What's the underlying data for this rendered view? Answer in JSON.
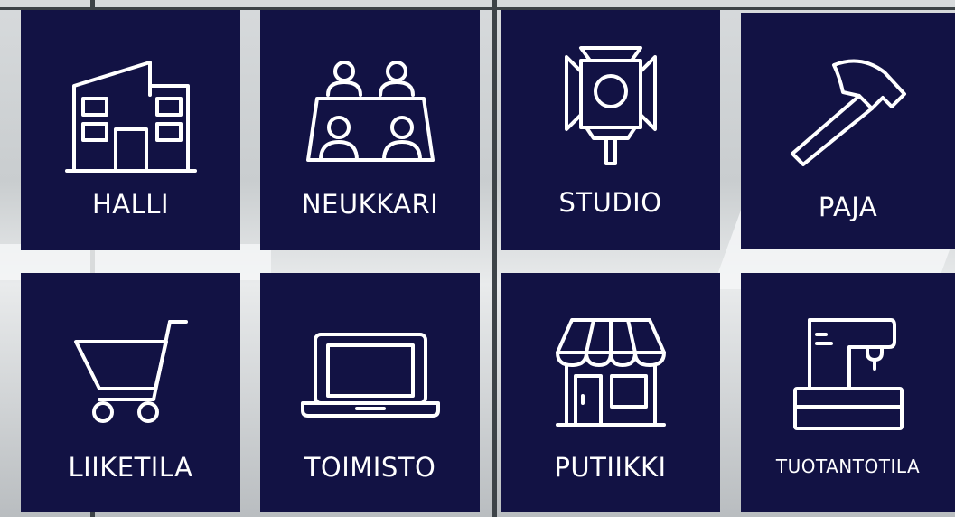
{
  "tiles": [
    {
      "label": "HALLI",
      "icon": "building-icon"
    },
    {
      "label": "NEUKKARI",
      "icon": "meeting-table-icon"
    },
    {
      "label": "STUDIO",
      "icon": "studio-light-icon"
    },
    {
      "label": "PAJA",
      "icon": "hammer-icon"
    },
    {
      "label": "LIIKETILA",
      "icon": "shopping-cart-icon"
    },
    {
      "label": "TOIMISTO",
      "icon": "laptop-icon"
    },
    {
      "label": "PUTIIKKI",
      "icon": "storefront-icon"
    },
    {
      "label": "TUOTANTOTILA",
      "icon": "sewing-machine-icon"
    }
  ],
  "colors": {
    "tile_bg": "#121244",
    "text": "#ffffff"
  }
}
